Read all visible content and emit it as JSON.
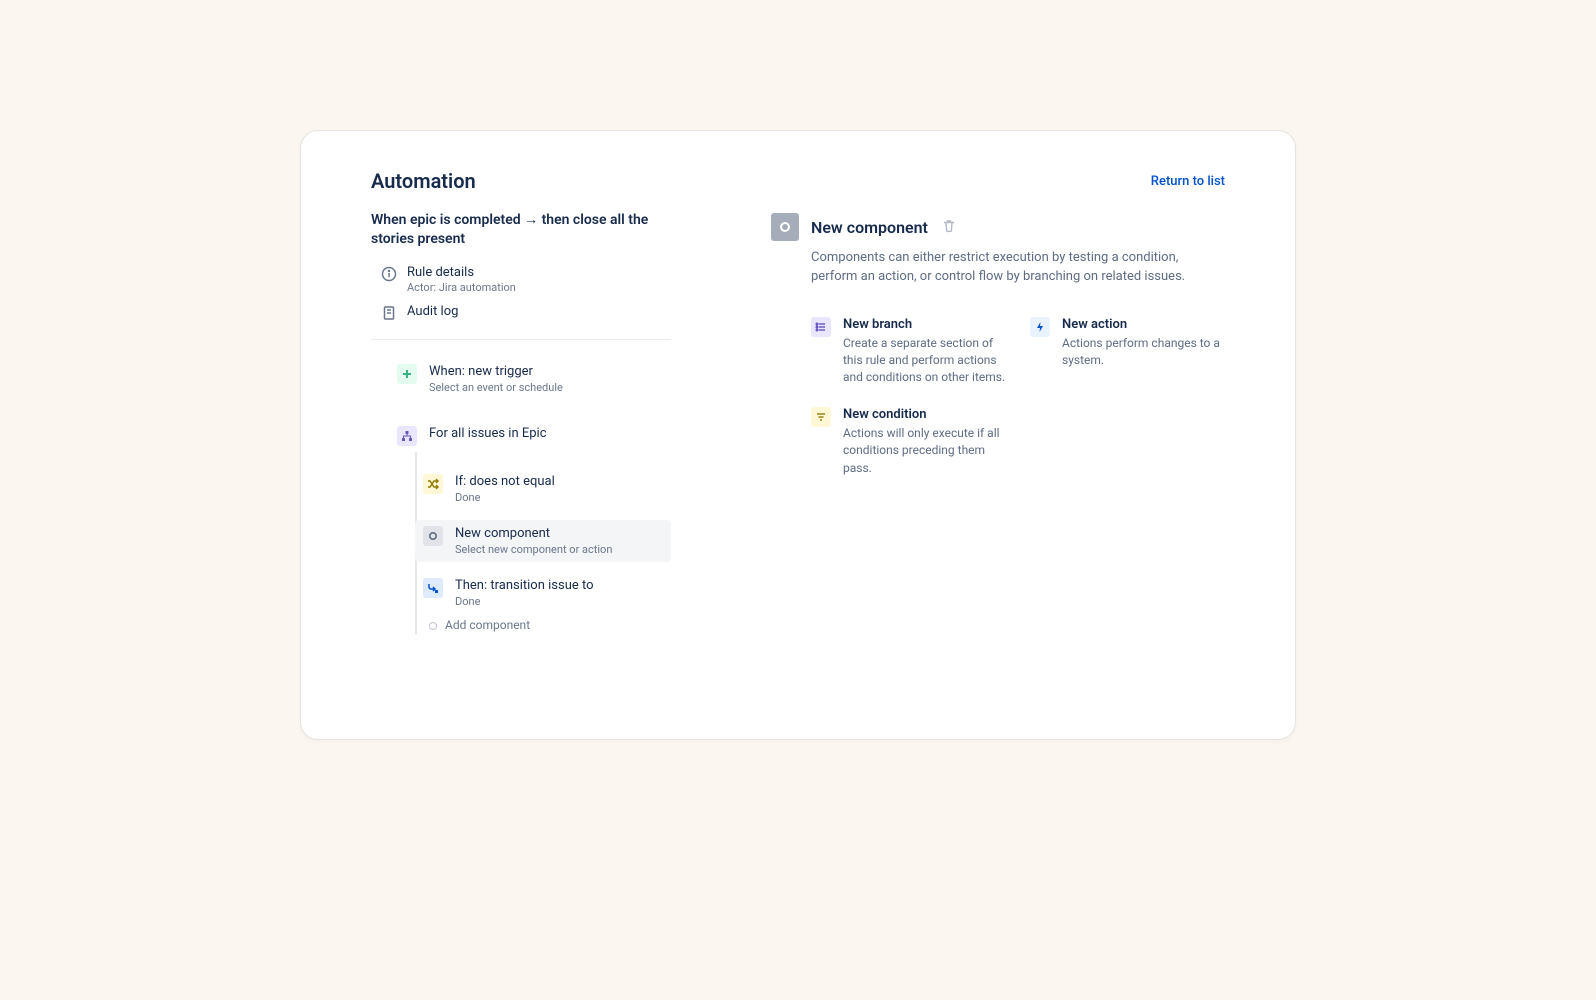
{
  "header": {
    "title": "Automation",
    "return_label": "Return to list"
  },
  "rule": {
    "name": "When epic is completed → then close all the stories present",
    "details_label": "Rule details",
    "details_sub": "Actor: Jira automation",
    "audit_label": "Audit log"
  },
  "flow": {
    "trigger": {
      "title": "When: new trigger",
      "sub": "Select an event or schedule"
    },
    "branch": {
      "title": "For all issues in Epic"
    },
    "condition": {
      "title": "If: does not equal",
      "sub": "Done"
    },
    "new_component": {
      "title": "New component",
      "sub": "Select new component or action"
    },
    "action": {
      "title": "Then: transition issue to",
      "sub": "Done"
    },
    "add_label": "Add component"
  },
  "panel": {
    "title": "New component",
    "description": "Components can either restrict execution by testing a condition, perform an action, or control flow by branching on related issues.",
    "options": {
      "branch": {
        "title": "New branch",
        "desc": "Create a separate section of this rule and perform actions and conditions on other items."
      },
      "action": {
        "title": "New action",
        "desc": "Actions perform changes to a system."
      },
      "condition": {
        "title": "New condition",
        "desc": "Actions will only execute if all conditions preceding them pass."
      }
    }
  }
}
